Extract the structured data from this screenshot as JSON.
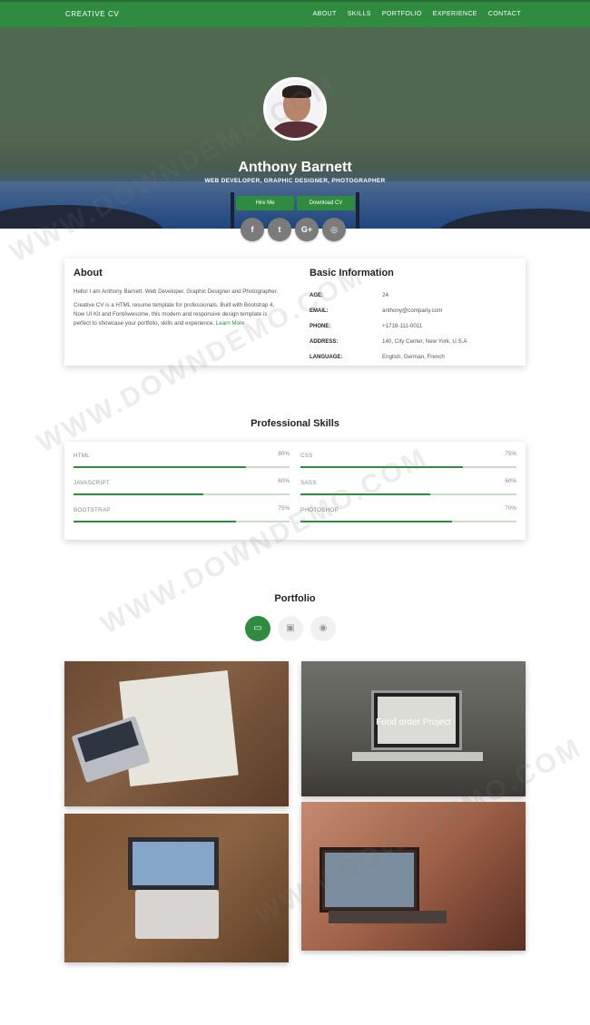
{
  "nav": {
    "brand": "CREATIVE CV",
    "links": [
      "ABOUT",
      "SKILLS",
      "PORTFOLIO",
      "EXPERIENCE",
      "CONTACT"
    ]
  },
  "hero": {
    "name": "Anthony Barnett",
    "subtitle": "WEB DEVELOPER, GRAPHIC DESIGNER, PHOTOGRAPHER",
    "hire_label": "Hire Me",
    "download_label": "Download CV"
  },
  "socials": [
    {
      "icon": "facebook-icon",
      "glyph": "f"
    },
    {
      "icon": "twitter-icon",
      "glyph": "t"
    },
    {
      "icon": "google-plus-icon",
      "glyph": "G+"
    },
    {
      "icon": "instagram-icon",
      "glyph": "◎"
    }
  ],
  "about": {
    "title": "About",
    "p1": "Hello! I am Anthony Barnett. Web Developer, Graphic Designer and Photographer.",
    "p2": "Creative CV is a HTML resume template for professionals. Built with Bootstrap 4, Now UI Kit and FontAwesome, this modern and responsive design template is perfect to showcase your portfolio, skills and experience.",
    "learn_more": "Learn More"
  },
  "basic_info": {
    "title": "Basic Information",
    "rows": [
      {
        "key": "AGE:",
        "value": "24"
      },
      {
        "key": "EMAIL:",
        "value": "anthony@company.com"
      },
      {
        "key": "PHONE:",
        "value": "+1718-111-0011"
      },
      {
        "key": "ADDRESS:",
        "value": "140, City Center, New York, U.S.A"
      },
      {
        "key": "LANGUAGE:",
        "value": "English, German, French"
      }
    ]
  },
  "skills": {
    "title": "Professional Skills",
    "items": [
      {
        "label": "HTML",
        "percent": "80%",
        "value": 0.8
      },
      {
        "label": "CSS",
        "percent": "75%",
        "value": 0.75
      },
      {
        "label": "JAVASCRIPT",
        "percent": "60%",
        "value": 0.6
      },
      {
        "label": "SASS",
        "percent": "60%",
        "value": 0.6
      },
      {
        "label": "BOOTSTRAP",
        "percent": "75%",
        "value": 0.75
      },
      {
        "label": "PHOTOSHOP",
        "percent": "70%",
        "value": 0.7
      }
    ]
  },
  "portfolio": {
    "title": "Portfolio",
    "tabs": [
      {
        "icon": "laptop-icon",
        "glyph": "▭",
        "active": true
      },
      {
        "icon": "image-icon",
        "glyph": "▣",
        "active": false
      },
      {
        "icon": "camera-icon",
        "glyph": "◉",
        "active": false
      }
    ],
    "overlay_title": "Food order Project"
  },
  "colors": {
    "accent": "#2e8b3f",
    "nav_bg": "#2e8b3f",
    "social_bg": "#7b7b7b"
  }
}
